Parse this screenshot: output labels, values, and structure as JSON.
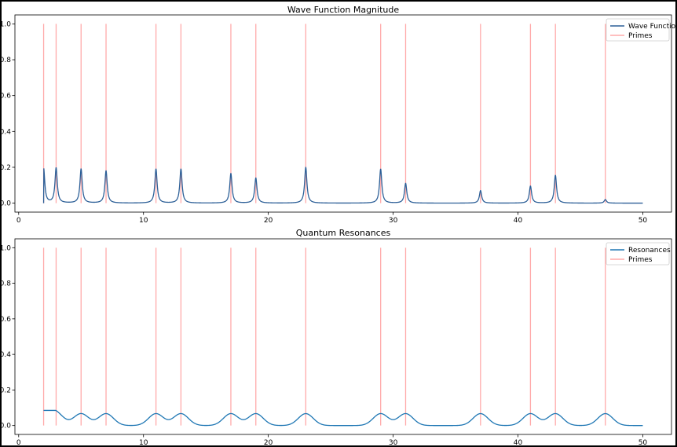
{
  "chart_data": [
    {
      "type": "line",
      "title": "Wave Function Magnitude",
      "xlabel": "",
      "ylabel": "",
      "xlim": [
        -0.3,
        52.3
      ],
      "ylim": [
        -0.05,
        1.05
      ],
      "xticks": [
        0,
        10,
        20,
        30,
        40,
        50
      ],
      "yticks": [
        0.0,
        0.2,
        0.4,
        0.6,
        0.8,
        1.0
      ],
      "xtick_labels": [
        "0",
        "10",
        "20",
        "30",
        "40",
        "50"
      ],
      "ytick_labels": [
        "0.0",
        "0.2",
        "0.4",
        "0.6",
        "0.8",
        "1.0"
      ],
      "grid": false,
      "legend_position": "top-right",
      "colors": {
        "series": "#2c5f97",
        "primes": "#ffaaaa"
      },
      "series": [
        {
          "name": "Wave Function",
          "kind": "peaks",
          "x_range": [
            2,
            50
          ],
          "primes": [
            2,
            3,
            5,
            7,
            11,
            13,
            17,
            19,
            23,
            29,
            31,
            37,
            41,
            43,
            47
          ],
          "peak_heights": [
            0.195,
            0.195,
            0.19,
            0.18,
            0.19,
            0.19,
            0.165,
            0.14,
            0.2,
            0.19,
            0.11,
            0.07,
            0.095,
            0.155,
            0.02
          ]
        },
        {
          "name": "Primes",
          "kind": "vlines",
          "x": [
            2,
            3,
            5,
            7,
            11,
            13,
            17,
            19,
            23,
            29,
            31,
            37,
            41,
            43,
            47
          ],
          "ymin": 0,
          "ymax": 1
        }
      ]
    },
    {
      "type": "line",
      "title": "Quantum Resonances",
      "xlabel": "",
      "ylabel": "",
      "xlim": [
        -0.3,
        52.3
      ],
      "ylim": [
        -0.05,
        1.05
      ],
      "xticks": [
        0,
        10,
        20,
        30,
        40,
        50
      ],
      "yticks": [
        0.0,
        0.2,
        0.4,
        0.6,
        0.8,
        1.0
      ],
      "xtick_labels": [
        "0",
        "10",
        "20",
        "30",
        "40",
        "50"
      ],
      "ytick_labels": [
        "0.0",
        "0.2",
        "0.4",
        "0.6",
        "0.8",
        "1.0"
      ],
      "grid": false,
      "legend_position": "top-right",
      "colors": {
        "series": "#1f77b4",
        "primes": "#ffaaaa"
      },
      "series": [
        {
          "name": "Resonances",
          "kind": "bumps",
          "x_range": [
            2,
            50
          ],
          "primes": [
            2,
            3,
            5,
            7,
            11,
            13,
            17,
            19,
            23,
            29,
            31,
            37,
            41,
            43,
            47
          ],
          "peak_height": 0.067
        },
        {
          "name": "Primes",
          "kind": "vlines",
          "x": [
            2,
            3,
            5,
            7,
            11,
            13,
            17,
            19,
            23,
            29,
            31,
            37,
            41,
            43,
            47
          ],
          "ymin": 0,
          "ymax": 1
        }
      ]
    }
  ]
}
